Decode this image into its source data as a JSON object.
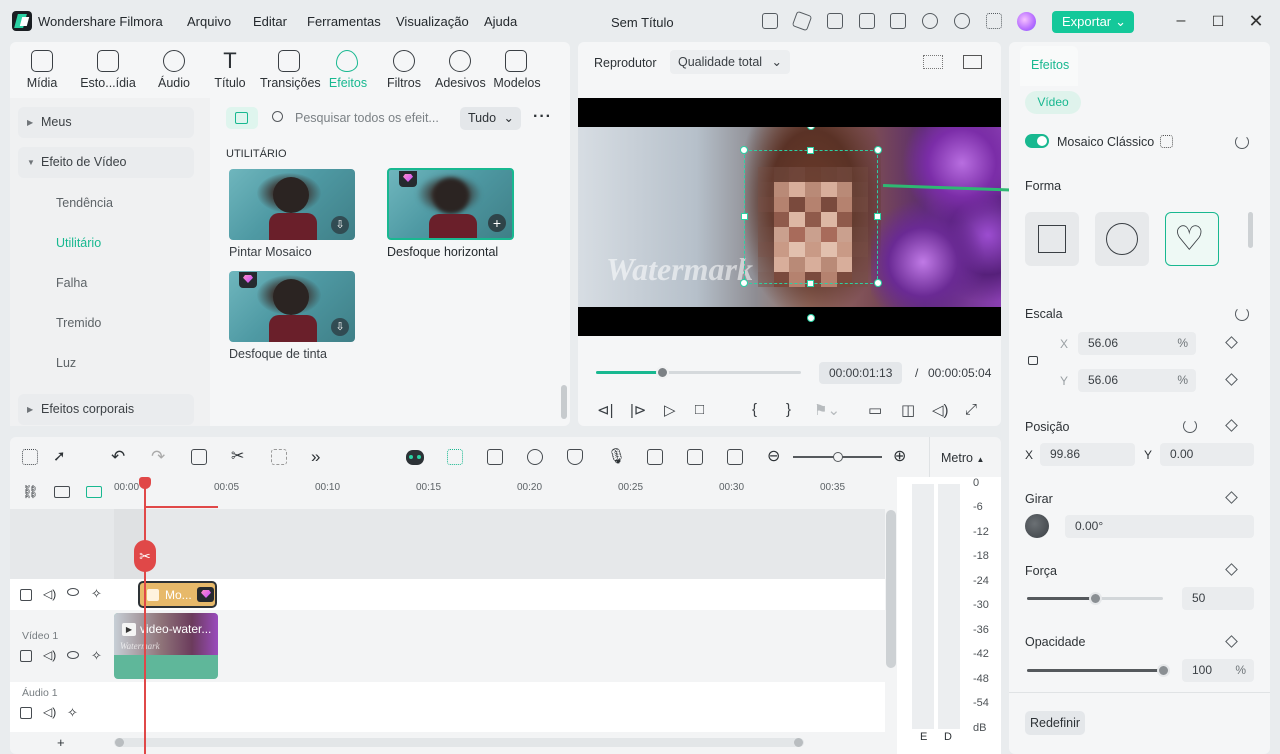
{
  "app": {
    "name": "Wondershare Filmora",
    "doc_title": "Sem Título"
  },
  "menu": [
    "Arquivo",
    "Editar",
    "Ferramentas",
    "Visualização",
    "Ajuda"
  ],
  "export_label": "Exportar",
  "media_tabs": [
    "Mídia",
    "Esto...ídia",
    "Áudio",
    "Título",
    "Transições",
    "Efeitos",
    "Filtros",
    "Adesivos",
    "Modelos"
  ],
  "sidebar": {
    "items": [
      "Meus",
      "Efeito de Vídeo",
      "Efeitos corporais"
    ],
    "subitems": [
      "Tendência",
      "Utilitário",
      "Falha",
      "Tremido",
      "Luz"
    ]
  },
  "search": {
    "placeholder": "Pesquisar todos os efeit...",
    "filter": "Tudo"
  },
  "section_title": "UTILITÁRIO",
  "effects": [
    "Pintar Mosaico",
    "Desfoque horizontal",
    "Desfoque de tinta"
  ],
  "player": {
    "label": "Reprodutor",
    "quality": "Qualidade total",
    "watermark": "Watermark",
    "current": "00:00:01:13",
    "sep": "/",
    "total": "00:00:05:04",
    "progress": 0.32
  },
  "right": {
    "tab": "Efeitos",
    "subtab": "Vídeo",
    "effect_name": "Mosaico Clássico",
    "shape_label": "Forma",
    "scale_label": "Escala",
    "x_label": "X",
    "y_label": "Y",
    "scale_x": "56.06",
    "scale_y": "56.06",
    "pct": "%",
    "position_label": "Posição",
    "pos_x": "99.86",
    "pos_y": "0.00",
    "rotate_label": "Girar",
    "rotate_val": "0.00°",
    "strength_label": "Força",
    "strength_val": "50",
    "strength_frac": 0.5,
    "opacity_label": "Opacidade",
    "opacity_val": "100",
    "opacity_frac": 1.0,
    "reset_btn": "Redefinir"
  },
  "timeline": {
    "meter_label": "Metro",
    "ruler": [
      "00:00",
      "00:05",
      "00:10",
      "00:15",
      "00:20",
      "00:25",
      "00:30",
      "00:35"
    ],
    "effect_clip": "Mo...",
    "video_clip": "video-water...",
    "clip_watermark": "Watermark",
    "track_video": "Vídeo 1",
    "track_audio": "Áudio 1",
    "db": [
      "0",
      "-6",
      "-12",
      "-18",
      "-24",
      "-30",
      "-36",
      "-42",
      "-48",
      "-54",
      "dB"
    ],
    "channels": [
      "E",
      "D"
    ],
    "add": "+"
  },
  "colors": {
    "accent": "#18b890",
    "selection": "#2bd1a3",
    "playhead": "#e04848"
  }
}
